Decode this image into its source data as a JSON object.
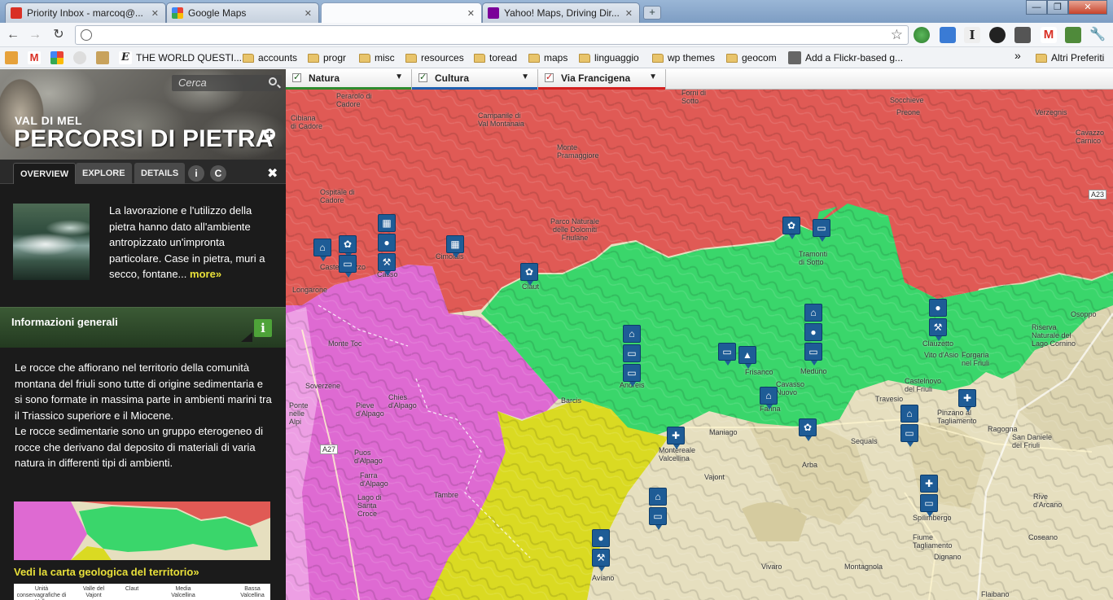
{
  "browser": {
    "tabs": [
      {
        "title": "Priority Inbox - marcoq@...",
        "favicon_color": "#d93025",
        "active": false
      },
      {
        "title": "Google Maps",
        "favicon_color": "#34a853",
        "active": false
      },
      {
        "title": "",
        "favicon_color": "#ffffff",
        "active": true
      },
      {
        "title": "Yahoo! Maps, Driving Dir...",
        "favicon_color": "#7b0099",
        "active": false
      }
    ],
    "new_tab_label": "+",
    "window_controls": {
      "minimize": "—",
      "maximize": "❐",
      "close": "✕"
    },
    "nav": {
      "back": "←",
      "forward": "→",
      "reload": "↻"
    },
    "address": "",
    "bookmarks": [
      {
        "label": "",
        "type": "icon",
        "color": "#e6a13a"
      },
      {
        "label": "",
        "type": "icon",
        "color": "#d93025"
      },
      {
        "label": "",
        "type": "icon",
        "color": "#4285f4"
      },
      {
        "label": "",
        "type": "icon",
        "color": "#777777"
      },
      {
        "label": "",
        "type": "icon",
        "color": "#c8a25c"
      },
      {
        "label": "THE WORLD QUESTI...",
        "type": "site"
      },
      {
        "label": "accounts",
        "type": "folder"
      },
      {
        "label": "progr",
        "type": "folder"
      },
      {
        "label": "misc",
        "type": "folder"
      },
      {
        "label": "resources",
        "type": "folder"
      },
      {
        "label": "toread",
        "type": "folder"
      },
      {
        "label": "maps",
        "type": "folder"
      },
      {
        "label": "linguaggio",
        "type": "folder"
      },
      {
        "label": "wp themes",
        "type": "folder"
      },
      {
        "label": "geocom",
        "type": "folder"
      },
      {
        "label": "Add a Flickr-based g...",
        "type": "site"
      }
    ],
    "bookmarks_overflow": "»",
    "other_bookmarks": "Altri Preferiti"
  },
  "sidebar": {
    "search_placeholder": "Cerca",
    "kicker": "VAL DI MEL",
    "title": "PERCORSI DI PIETRA",
    "tabs": [
      "OVERVIEW",
      "EXPLORE",
      "DETAILS"
    ],
    "info_icon": "i",
    "c_icon": "C",
    "close_icon": "✖",
    "intro": "La lavorazione e l'utilizzo della pietra hanno dato all'ambiente antropizzato un'impronta particolare. Case in pietra, muri a secco, fontane...",
    "intro_more": "more»",
    "section_title": "Informazioni generali",
    "section_icon": "i",
    "paragraph1": "Le rocce che affiorano nel territorio della comunità montana del friuli sono tutte di origine sedimentaria e si sono formate in massima parte in ambienti marini tra il Triassico superiore e il Miocene.",
    "paragraph2": "Le rocce sedimentarie sono un gruppo eterogeneo di rocce che derivano dal deposito di materiali di varia natura in differenti tipi di ambienti.",
    "geomap_link": "Vedi la carta geologica del territorio»",
    "legend_columns": [
      "Unità conservagrafiche di ... Valle ...",
      "Valle del Vajont",
      "Claut",
      "Media Valcellina",
      "Bassa Valcellina"
    ]
  },
  "map": {
    "layers": [
      {
        "label": "Natura",
        "checked": true,
        "color": "#2e8b2e"
      },
      {
        "label": "Cultura",
        "checked": true,
        "color": "#1e5fae"
      },
      {
        "label": "Via Francigena",
        "checked": true,
        "color": "#d32020"
      }
    ],
    "colors": {
      "red": "#e05a55",
      "green": "#3ad66b",
      "magenta": "#de6ad2",
      "yellow": "#dada22",
      "base": "#e6dfbf"
    },
    "towns": [
      {
        "name": "Perarolo di Cadore"
      },
      {
        "name": "Cibiana di Cadore"
      },
      {
        "name": "Ospitale di Cadore"
      },
      {
        "name": "Forni di Sotto"
      },
      {
        "name": "Socchieve"
      },
      {
        "name": "Preone"
      },
      {
        "name": "Verzegnis"
      },
      {
        "name": "Cavazzo Carnico"
      },
      {
        "name": "Campanile di Val Montanaia"
      },
      {
        "name": "Monte Pramaggiore"
      },
      {
        "name": "Parco Naturale delle Dolomiti Friulane"
      },
      {
        "name": "Castellavazzo"
      },
      {
        "name": "Casso"
      },
      {
        "name": "Cimolais"
      },
      {
        "name": "Claut"
      },
      {
        "name": "Longarone"
      },
      {
        "name": "Tramonti di Sotto"
      },
      {
        "name": "Monte Toc"
      },
      {
        "name": "Soverzene"
      },
      {
        "name": "Ponte nelle Alpi"
      },
      {
        "name": "Chies d'Alpago"
      },
      {
        "name": "Pieve d'Alpago"
      },
      {
        "name": "Puos d'Alpago"
      },
      {
        "name": "Farra d'Alpago"
      },
      {
        "name": "Lago di Santa Croce"
      },
      {
        "name": "Tambre"
      },
      {
        "name": "Andreis"
      },
      {
        "name": "Barcis"
      },
      {
        "name": "Frisanco"
      },
      {
        "name": "Meduno"
      },
      {
        "name": "Cavasso Nuovo"
      },
      {
        "name": "Fanna"
      },
      {
        "name": "Maniago"
      },
      {
        "name": "Montereale Valcellina"
      },
      {
        "name": "Vajont"
      },
      {
        "name": "Arba"
      },
      {
        "name": "Sequals"
      },
      {
        "name": "Travesio"
      },
      {
        "name": "Clauzetto"
      },
      {
        "name": "Vito d'Asio"
      },
      {
        "name": "Forgaria nel Friuli"
      },
      {
        "name": "Castelnovo del Friuli"
      },
      {
        "name": "Pinzano al Tagliamento"
      },
      {
        "name": "Ragogna"
      },
      {
        "name": "San Daniele del Friuli"
      },
      {
        "name": "Riserva Naturale del Lago Cornino"
      },
      {
        "name": "Osoppo"
      },
      {
        "name": "Spilimbergo"
      },
      {
        "name": "Rive d'Arcano"
      },
      {
        "name": "Coseano"
      },
      {
        "name": "Fiume Tagliamento"
      },
      {
        "name": "Dignano"
      },
      {
        "name": "Vivaro"
      },
      {
        "name": "Montagnola"
      },
      {
        "name": "Flaibano"
      },
      {
        "name": "Aviano"
      },
      {
        "name": "A27"
      },
      {
        "name": "A23"
      }
    ]
  }
}
